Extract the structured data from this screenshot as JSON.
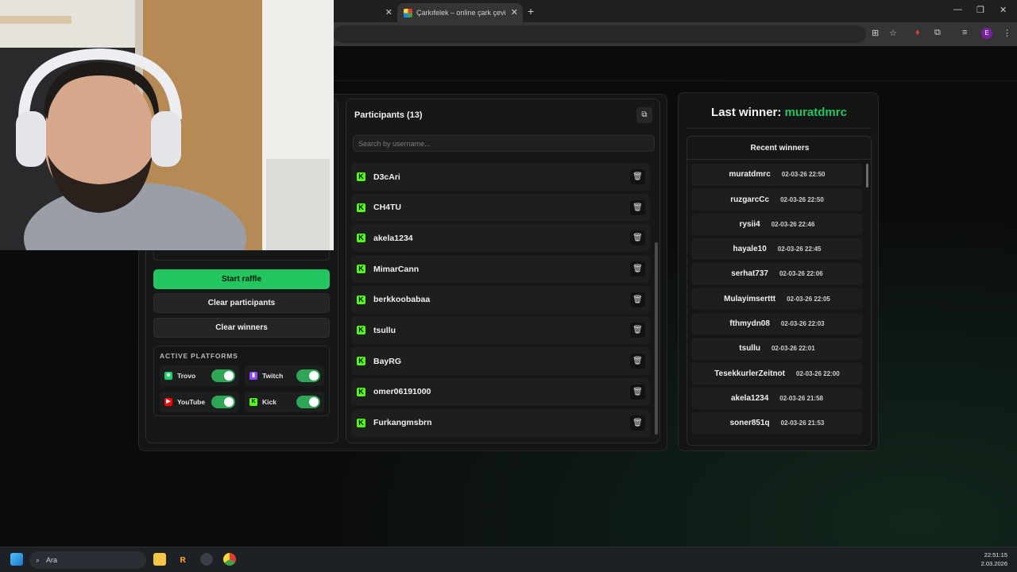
{
  "browser": {
    "tabs": [
      {
        "title": "",
        "active": false
      },
      {
        "title": "Çarkıfelek – online çark çevirme",
        "active": true
      }
    ]
  },
  "raffle": {
    "start_label": "Start raffle",
    "clear_participants_label": "Clear participants",
    "clear_winners_label": "Clear winners",
    "platforms_title": "ACTIVE PLATFORMS",
    "platforms": [
      {
        "name": "Trovo",
        "enabled": true,
        "color": "#19d66b"
      },
      {
        "name": "Twitch",
        "enabled": true,
        "color": "#9146ff"
      },
      {
        "name": "YouTube",
        "enabled": true,
        "color": "#ff0000"
      },
      {
        "name": "Kick",
        "enabled": true,
        "color": "#53fc18"
      }
    ]
  },
  "participants": {
    "title": "Participants (13)",
    "search_placeholder": "Search by username...",
    "items": [
      "D3cAri",
      "CH4TU",
      "akela1234",
      "MimarCann",
      "berkkoobabaa",
      "tsullu",
      "BayRG",
      "omer06191000",
      "Furkangmsbrn"
    ]
  },
  "winners": {
    "last_label": "Last winner:",
    "last_name": "muratdmrc",
    "recent_title": "Recent winners",
    "items": [
      {
        "name": "muratdmrc",
        "date": "02-03-26 22:50"
      },
      {
        "name": "ruzgarcCc",
        "date": "02-03-26 22:50"
      },
      {
        "name": "rysii4",
        "date": "02-03-26 22:46"
      },
      {
        "name": "hayale10",
        "date": "02-03-26 22:45"
      },
      {
        "name": "serhat737",
        "date": "02-03-26 22:06"
      },
      {
        "name": "Mulayimserttt",
        "date": "02-03-26 22:05"
      },
      {
        "name": "fthmydn08",
        "date": "02-03-26 22:03"
      },
      {
        "name": "tsullu",
        "date": "02-03-26 22:01"
      },
      {
        "name": "TesekkurlerZeitnot",
        "date": "02-03-26 22:00"
      },
      {
        "name": "akela1234",
        "date": "02-03-26 21:58"
      },
      {
        "name": "soner851q",
        "date": "02-03-26 21:53"
      }
    ]
  },
  "taskbar": {
    "search_label": "Ara",
    "time": "22:51:15",
    "date": "2.03.2026"
  },
  "colors": {
    "accent": "#22c55e",
    "kick": "#53fc18"
  }
}
